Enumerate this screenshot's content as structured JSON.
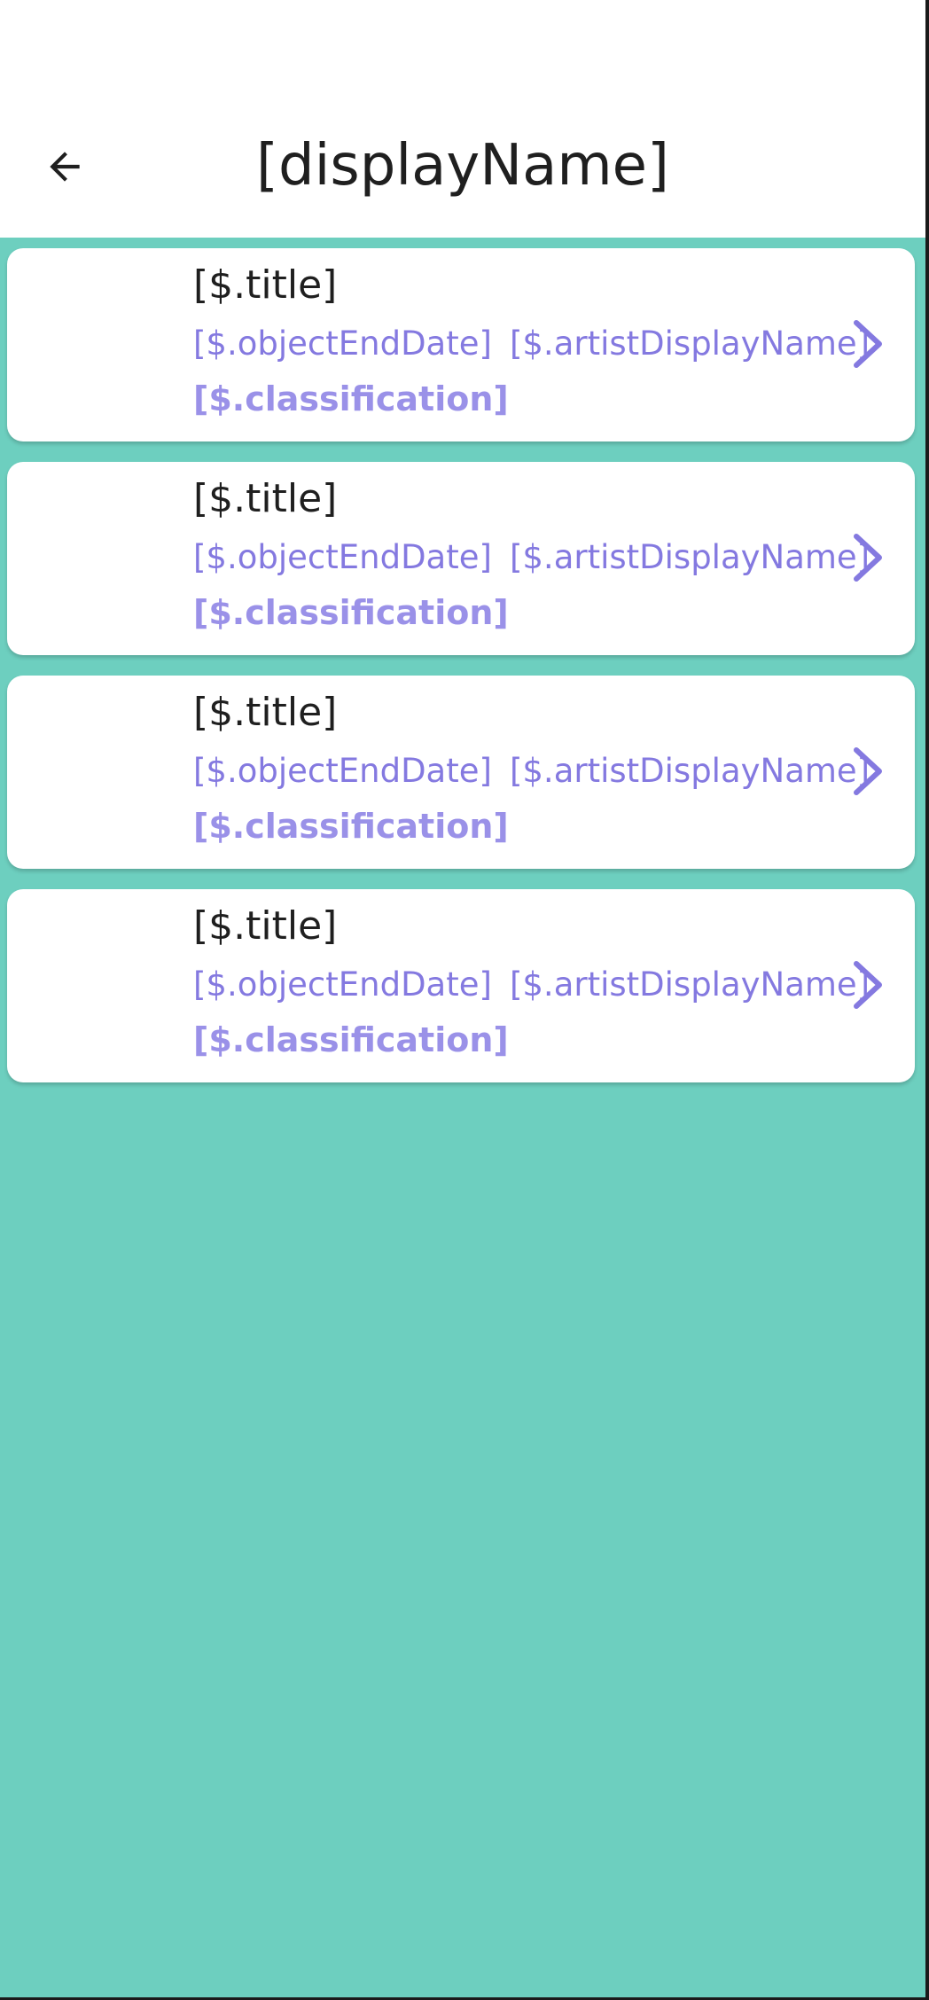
{
  "header": {
    "title": "[displayName]"
  },
  "colors": {
    "background": "#6dcfbf",
    "accent": "#8479e0",
    "card": "#ffffff"
  },
  "items": [
    {
      "title": "[$.title]",
      "end_date": "[$.objectEndDate]",
      "artist": "[$.artistDisplayName]",
      "classification": "[$.classification]"
    },
    {
      "title": "[$.title]",
      "end_date": "[$.objectEndDate]",
      "artist": "[$.artistDisplayName]",
      "classification": "[$.classification]"
    },
    {
      "title": "[$.title]",
      "end_date": "[$.objectEndDate]",
      "artist": "[$.artistDisplayName]",
      "classification": "[$.classification]"
    },
    {
      "title": "[$.title]",
      "end_date": "[$.objectEndDate]",
      "artist": "[$.artistDisplayName]",
      "classification": "[$.classification]"
    }
  ]
}
